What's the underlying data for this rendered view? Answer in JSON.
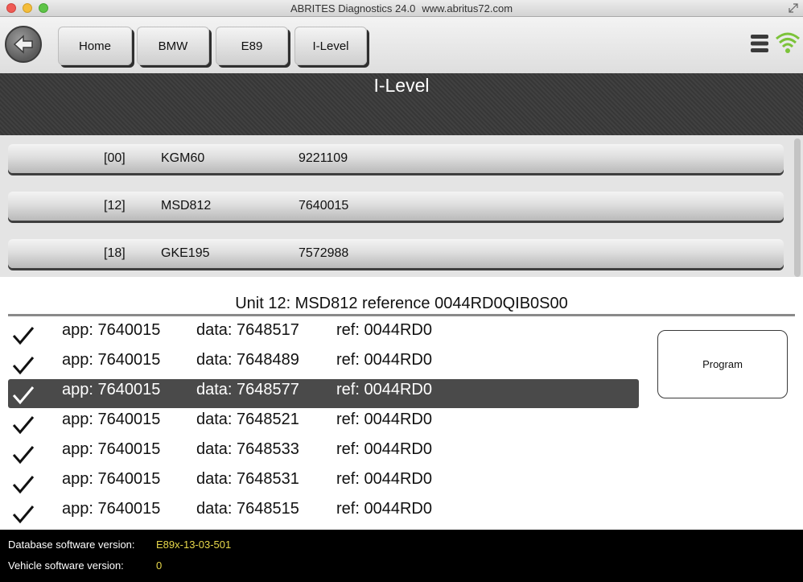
{
  "window": {
    "title": "ABRITES Diagnostics 24.0",
    "url": "www.abritus72.com"
  },
  "toolbar": {
    "breadcrumbs": [
      "Home",
      "BMW",
      "E89",
      "I-Level"
    ]
  },
  "header": {
    "title": "I-Level"
  },
  "modules": [
    {
      "index": "[00]",
      "name": "KGM60",
      "number": "9221109"
    },
    {
      "index": "[12]",
      "name": "MSD812",
      "number": "7640015"
    },
    {
      "index": "[18]",
      "name": "GKE195",
      "number": "7572988"
    }
  ],
  "detail": {
    "heading": "Unit 12: MSD812 reference 0044RD0QIB0S00",
    "selected_index": 2,
    "versions": [
      {
        "app": "app: 7640015",
        "data": "data: 7648517",
        "ref": "ref: 0044RD0"
      },
      {
        "app": "app: 7640015",
        "data": "data: 7648489",
        "ref": "ref: 0044RD0"
      },
      {
        "app": "app: 7640015",
        "data": "data: 7648577",
        "ref": "ref: 0044RD0"
      },
      {
        "app": "app: 7640015",
        "data": "data: 7648521",
        "ref": "ref: 0044RD0"
      },
      {
        "app": "app: 7640015",
        "data": "data: 7648533",
        "ref": "ref: 0044RD0"
      },
      {
        "app": "app: 7640015",
        "data": "data: 7648531",
        "ref": "ref: 0044RD0"
      },
      {
        "app": "app: 7640015",
        "data": "data: 7648515",
        "ref": "ref: 0044RD0"
      }
    ],
    "program_label": "Program"
  },
  "footer": {
    "db_label": "Database software version:",
    "db_value": "E89x-13-03-501",
    "vehicle_label": "Vehicle software version:",
    "vehicle_value": "0"
  },
  "colors": {
    "footer_value": "#e8d84a",
    "selected_row": "#4a4a4a",
    "wifi": "#7cc33a"
  }
}
